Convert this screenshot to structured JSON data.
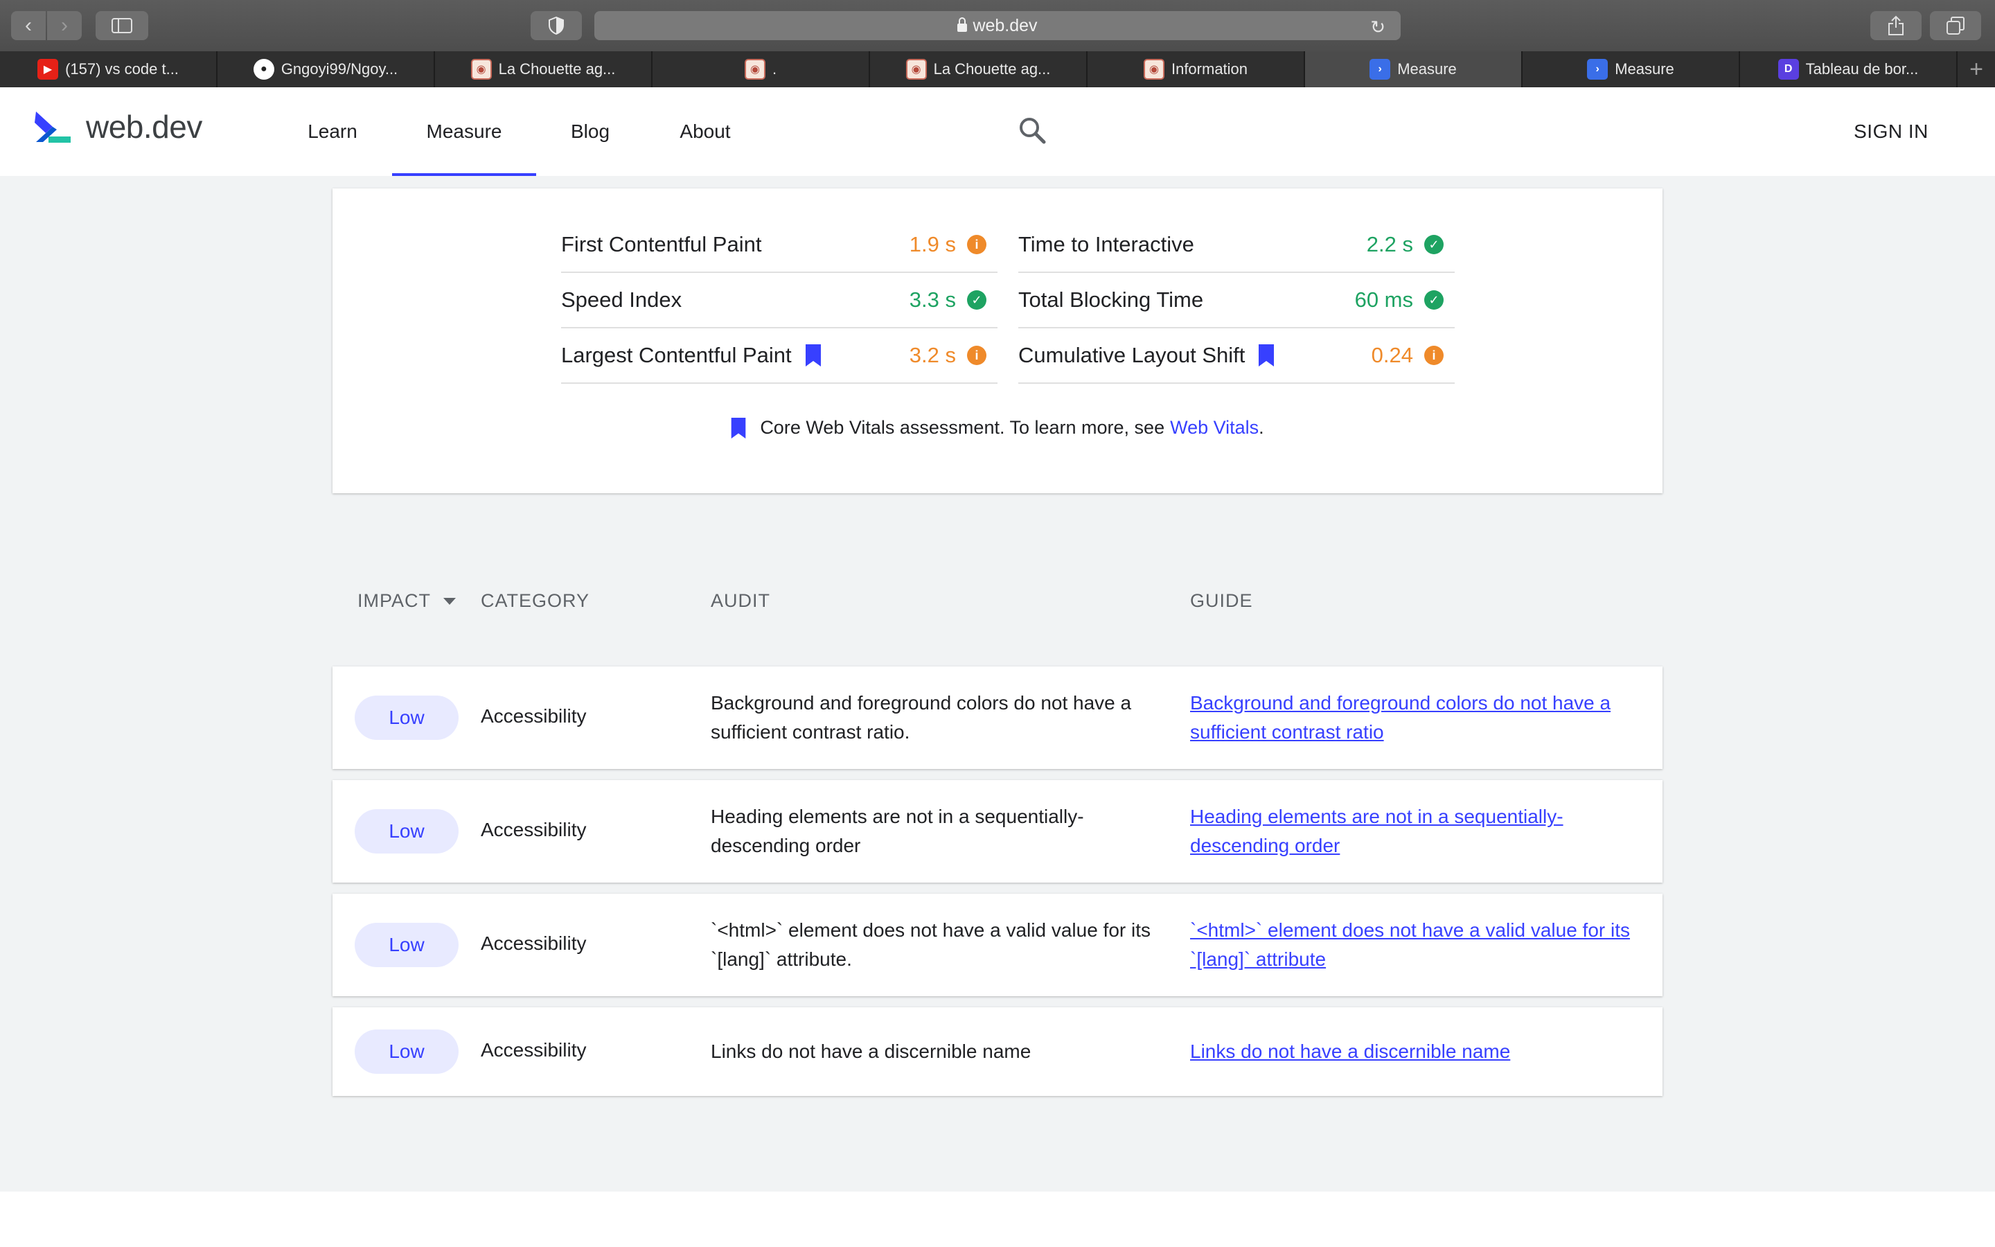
{
  "browser": {
    "address": "web.dev",
    "tabs": [
      {
        "title": "(157) vs code t...",
        "favicon": "youtube-icon",
        "active": false
      },
      {
        "title": "Gngoyi99/Ngoy...",
        "favicon": "github-icon",
        "active": false
      },
      {
        "title": "La Chouette ag...",
        "favicon": "owl-icon",
        "active": false
      },
      {
        "title": ".",
        "favicon": "owl-icon",
        "active": false
      },
      {
        "title": "La Chouette ag...",
        "favicon": "owl-icon",
        "active": false
      },
      {
        "title": "Information",
        "favicon": "owl-icon",
        "active": false
      },
      {
        "title": "Measure",
        "favicon": "webdev-icon",
        "active": true
      },
      {
        "title": "Measure",
        "favicon": "webdev-icon",
        "active": false
      },
      {
        "title": "Tableau de bor...",
        "favicon": "dashboard-icon",
        "active": false
      }
    ]
  },
  "header": {
    "logo_text": "web.dev",
    "nav": {
      "learn": "Learn",
      "measure": "Measure",
      "blog": "Blog",
      "about": "About"
    },
    "active_nav": "Measure",
    "sign_in": "SIGN IN"
  },
  "metrics": [
    {
      "label": "First Contentful Paint",
      "value": "1.9 s",
      "status": "average",
      "core_vital": false
    },
    {
      "label": "Time to Interactive",
      "value": "2.2 s",
      "status": "good",
      "core_vital": false
    },
    {
      "label": "Speed Index",
      "value": "3.3 s",
      "status": "good",
      "core_vital": false
    },
    {
      "label": "Total Blocking Time",
      "value": "60 ms",
      "status": "good",
      "core_vital": false
    },
    {
      "label": "Largest Contentful Paint",
      "value": "3.2 s",
      "status": "average",
      "core_vital": true
    },
    {
      "label": "Cumulative Layout Shift",
      "value": "0.24",
      "status": "average",
      "core_vital": true
    }
  ],
  "cwv_note": {
    "text": "Core Web Vitals assessment. To learn more, see",
    "link": "Web Vitals",
    "end": "."
  },
  "table": {
    "headers": {
      "impact": "IMPACT",
      "category": "CATEGORY",
      "audit": "AUDIT",
      "guide": "GUIDE"
    },
    "rows": [
      {
        "impact": "Low",
        "category": "Accessibility",
        "audit": "Background and foreground colors do not have a sufficient contrast ratio.",
        "guide": "Background and foreground colors do not have a sufficient contrast ratio"
      },
      {
        "impact": "Low",
        "category": "Accessibility",
        "audit": "Heading elements are not in a sequentially-descending order",
        "guide": "Heading elements are not in a sequentially-descending order"
      },
      {
        "impact": "Low",
        "category": "Accessibility",
        "audit": "`<html>` element does not have a valid value for its `[lang]` attribute.",
        "guide": "`<html>` element does not have a valid value for its `[lang]` attribute"
      },
      {
        "impact": "Low",
        "category": "Accessibility",
        "audit": "Links do not have a discernible name",
        "guide": "Links do not have a discernible name"
      }
    ]
  },
  "colors": {
    "accent": "#3740ff",
    "good": "#1ea362",
    "average": "#ef8a2a",
    "page_bg": "#f1f3f4"
  }
}
